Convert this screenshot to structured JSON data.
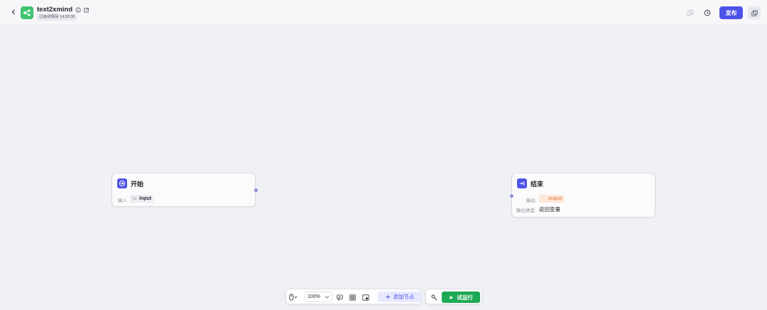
{
  "header": {
    "title": "text2xmind",
    "autosave": "已自动保存 14:30:30",
    "publish_label": "发布",
    "icons": [
      "back-icon",
      "app-logo-icon",
      "info-icon",
      "edit-icon",
      "layers-icon",
      "history-icon",
      "copy-icon"
    ]
  },
  "nodes": {
    "start": {
      "title": "开始",
      "input_label": "输入",
      "var_type": "Str",
      "var_name": "input"
    },
    "end": {
      "title": "结束",
      "output_label": "输出",
      "var_name": "output",
      "output_type_label": "输出类型",
      "output_type_value": "返回变量"
    }
  },
  "toolbar": {
    "zoom": "100%",
    "add_node_label": "添加节点",
    "run_label": "试运行"
  },
  "colors": {
    "accent": "#4d53e8",
    "run": "#1ea954",
    "app_icon": "#3ec46d"
  }
}
